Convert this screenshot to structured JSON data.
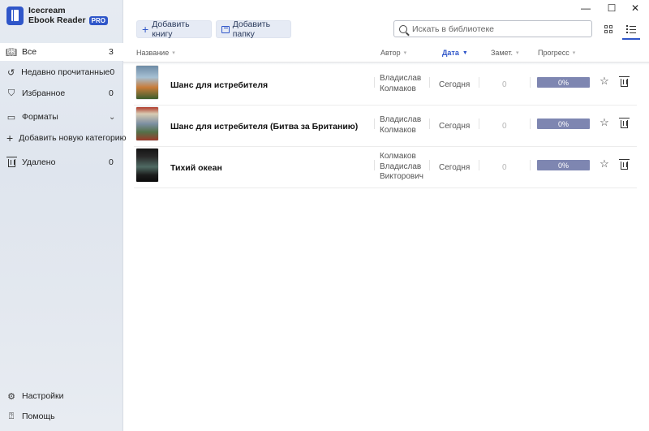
{
  "app": {
    "name_line1": "Icecream",
    "name_line2": "Ebook Reader",
    "badge": "PRO",
    "accent": "#2f56c9"
  },
  "window_controls": {
    "minimize": "—",
    "maximize": "☐",
    "close": "✕"
  },
  "sidebar": {
    "items": [
      {
        "icon": "book-icon",
        "label": "Все",
        "count": "3",
        "active": true
      },
      {
        "icon": "history-icon",
        "label": "Недавно прочитанные",
        "count": "0"
      },
      {
        "icon": "bookmark-icon",
        "label": "Избранное",
        "count": "0"
      },
      {
        "icon": "folder-icon",
        "label": "Форматы",
        "chevron": "⌄"
      },
      {
        "icon": "plus-icon",
        "label": "Добавить новую категорию"
      },
      {
        "icon": "trash-icon",
        "label": "Удалено",
        "count": "0"
      }
    ],
    "footer": [
      {
        "icon": "gear-icon",
        "label": "Настройки"
      },
      {
        "icon": "help-icon",
        "label": "Помощь"
      }
    ]
  },
  "toolbar": {
    "add_book": "Добавить книгу",
    "add_folder": "Добавить папку",
    "search_placeholder": "Искать в библиотеке",
    "view": "list"
  },
  "table": {
    "columns": {
      "name": "Название",
      "author": "Автор",
      "date": "Дата",
      "notes": "Замет.",
      "progress": "Прогресс"
    },
    "sorted_by": "date",
    "rows": [
      {
        "title": "Шанс для истребителя",
        "author": [
          "Владислав",
          "Колмаков"
        ],
        "date": "Сегодня",
        "notes": "0",
        "progress": "0%"
      },
      {
        "title": "Шанс для истребителя (Битва за Британию)",
        "author": [
          "Владислав",
          "Колмаков"
        ],
        "date": "Сегодня",
        "notes": "0",
        "progress": "0%"
      },
      {
        "title": "Тихий океан",
        "author": [
          "Колмаков",
          "Владислав",
          "Викторович"
        ],
        "date": "Сегодня",
        "notes": "0",
        "progress": "0%"
      }
    ]
  }
}
